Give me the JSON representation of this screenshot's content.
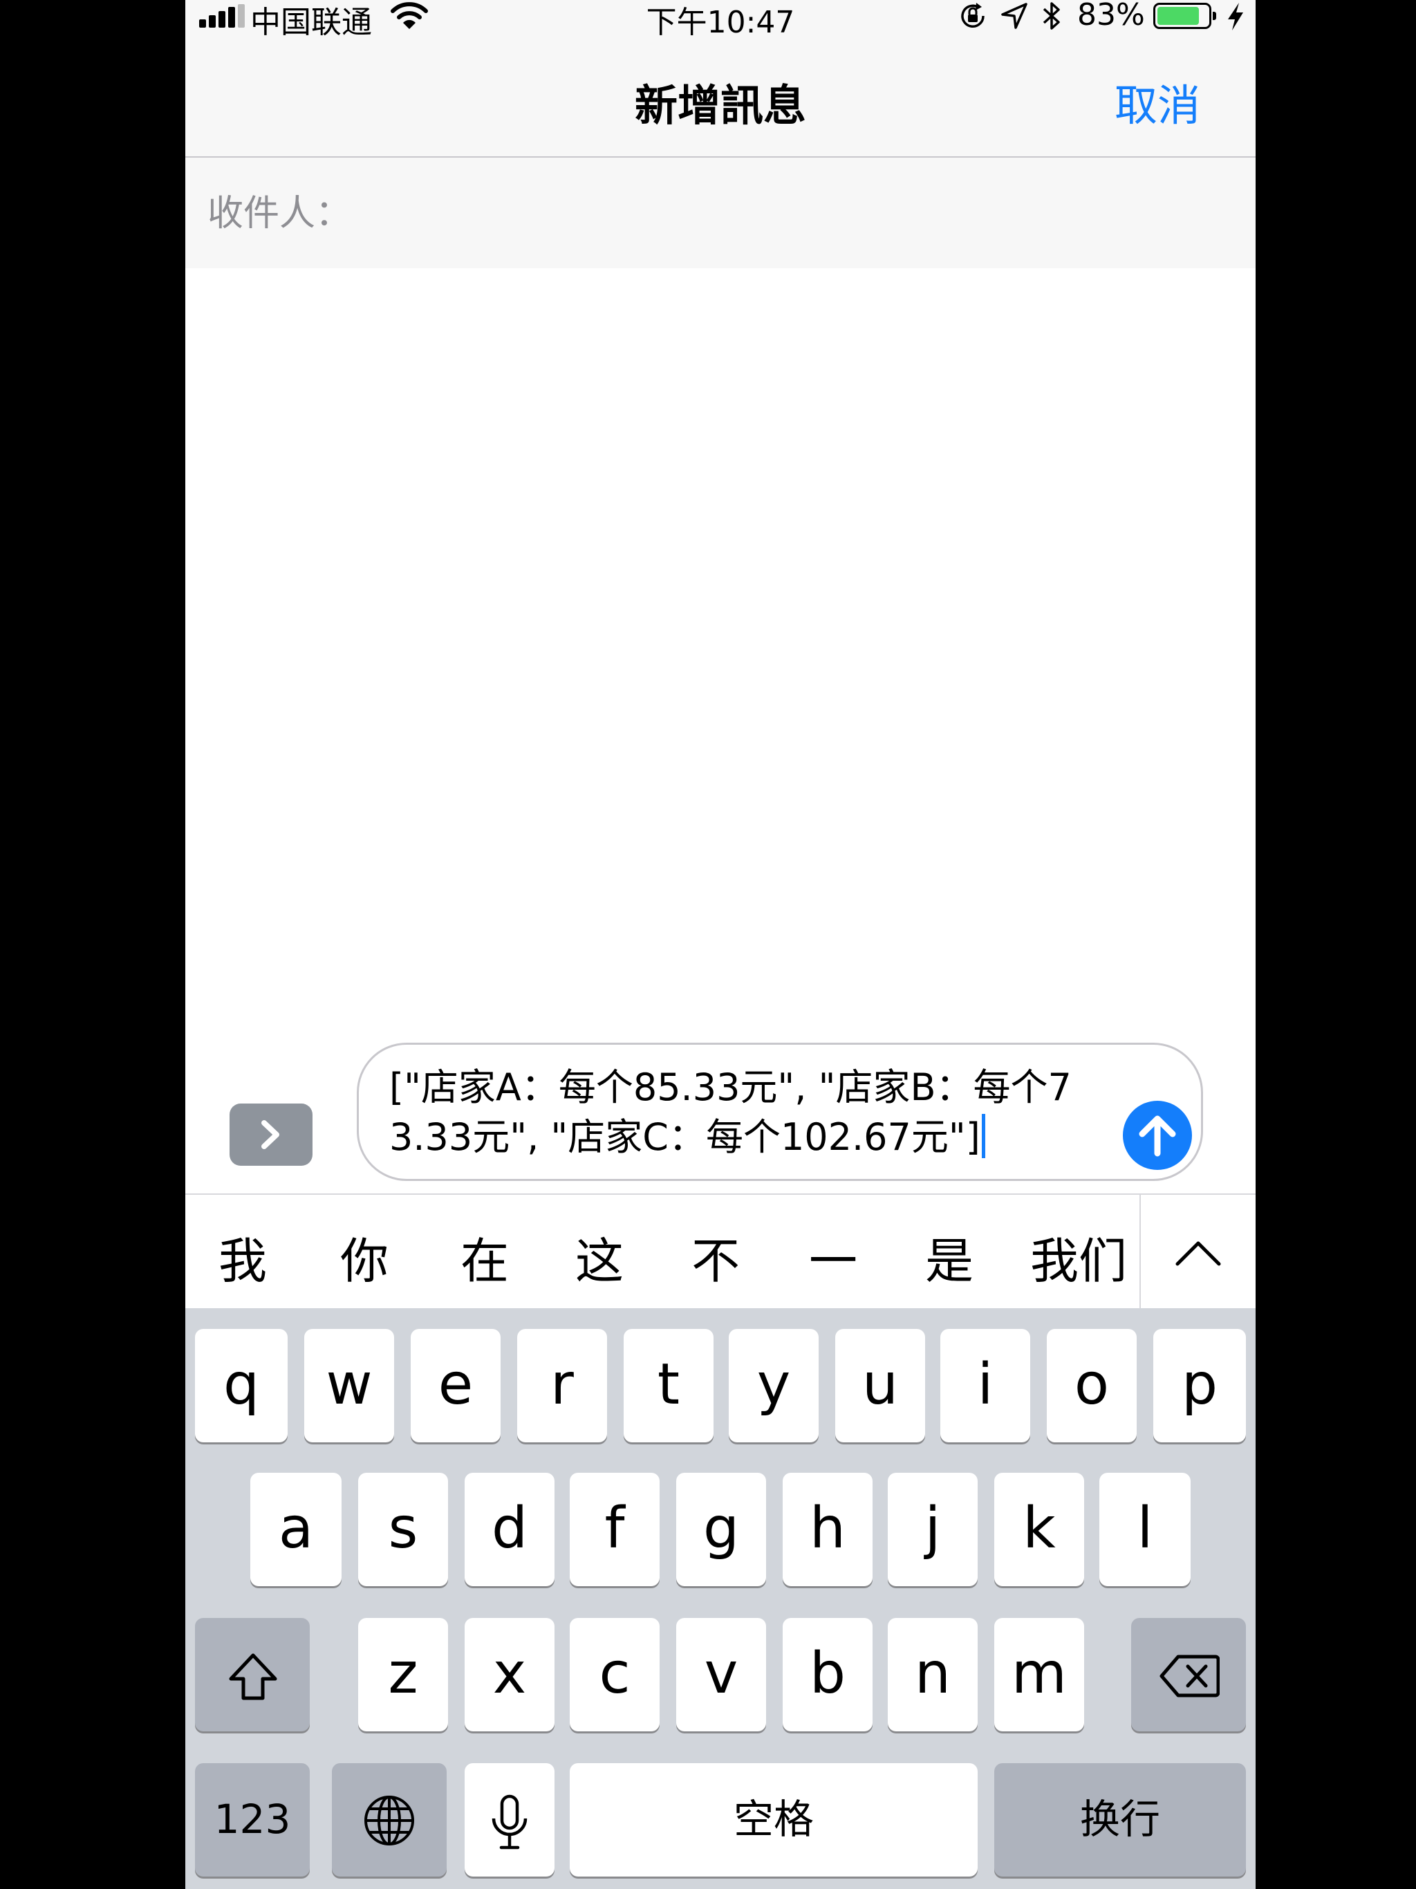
{
  "status_bar": {
    "carrier": "中国联通",
    "time": "下午10:47",
    "battery_percent": "83%",
    "battery_level": 0.83
  },
  "nav": {
    "title": "新增訊息",
    "cancel_label": "取消"
  },
  "recipient": {
    "label": "收件人："
  },
  "composer": {
    "text": "[\"店家A：每个85.33元\", \"店家B：每个73.33元\", \"店家C：每个102.67元\"]"
  },
  "candidates": [
    "我",
    "你",
    "在",
    "这",
    "不",
    "一",
    "是",
    "我们"
  ],
  "keyboard": {
    "row1": [
      "q",
      "w",
      "e",
      "r",
      "t",
      "y",
      "u",
      "i",
      "o",
      "p"
    ],
    "row2": [
      "a",
      "s",
      "d",
      "f",
      "g",
      "h",
      "j",
      "k",
      "l"
    ],
    "row3": [
      "z",
      "x",
      "c",
      "v",
      "b",
      "n",
      "m"
    ],
    "numbers_label": "123",
    "space_label": "空格",
    "return_label": "换行"
  },
  "colors": {
    "accent": "#147efb",
    "battery": "#4cd964",
    "keyboard_bg": "#d1d5db"
  },
  "icons": [
    "signal-icon",
    "wifi-icon",
    "orientation-lock-icon",
    "location-icon",
    "bluetooth-icon",
    "battery-icon",
    "charging-icon",
    "chevron-right-icon",
    "arrow-up-icon",
    "chevron-up-icon",
    "shift-icon",
    "delete-icon",
    "globe-icon",
    "microphone-icon"
  ]
}
